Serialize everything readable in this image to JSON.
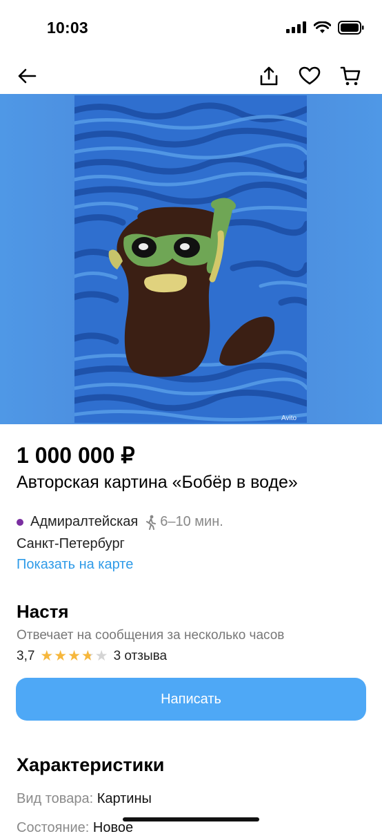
{
  "status_bar": {
    "time": "10:03"
  },
  "nav": {
    "icons": [
      "back-arrow-icon",
      "share-icon",
      "heart-icon",
      "cart-icon"
    ]
  },
  "image": {
    "watermark": "Avito"
  },
  "listing": {
    "price": "1 000 000 ₽",
    "title": "Авторская картина «Бобёр в воде»",
    "metro": "Адмиралтейская",
    "metro_color": "#7a2fa0",
    "walk_time": "6–10 мин.",
    "city": "Санкт-Петербург",
    "map_link": "Показать на карте"
  },
  "seller": {
    "name": "Настя",
    "reply_info": "Отвечает на сообщения за несколько часов",
    "rating": "3,7",
    "stars": 3.7,
    "reviews": "3 отзыва",
    "write_button": "Написать"
  },
  "characteristics": {
    "heading": "Характеристики",
    "items": [
      {
        "label": "Вид товара:",
        "value": "Картины"
      },
      {
        "label": "Состояние:",
        "value": "Новое"
      }
    ]
  },
  "colors": {
    "accent": "#4ea8f6",
    "link": "#2f9be8",
    "star": "#f6b73c"
  }
}
